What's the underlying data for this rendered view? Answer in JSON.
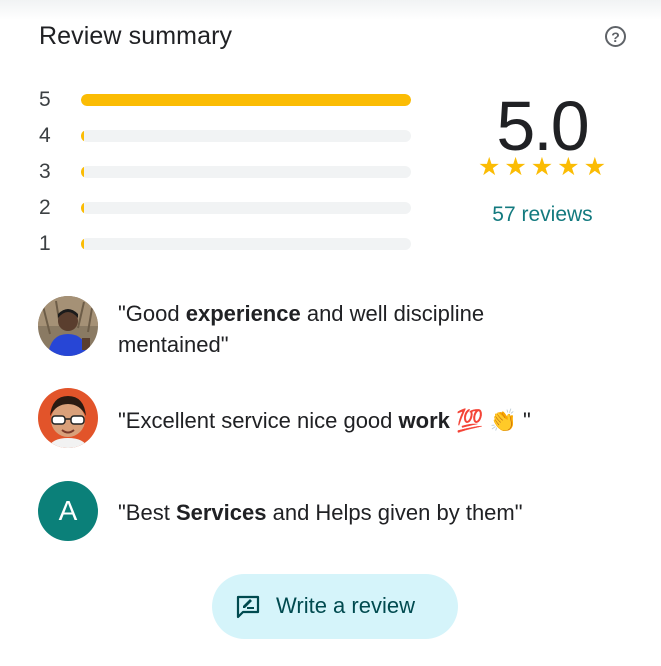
{
  "header": {
    "title": "Review summary",
    "help_glyph": "?"
  },
  "rating_bars": [
    {
      "star": "5",
      "fraction": 1.0
    },
    {
      "star": "4",
      "fraction": 0.0
    },
    {
      "star": "3",
      "fraction": 0.0
    },
    {
      "star": "2",
      "fraction": 0.0
    },
    {
      "star": "1",
      "fraction": 0.0
    }
  ],
  "summary": {
    "average": "5.0",
    "stars_filled": 5,
    "review_count_text": "57 reviews"
  },
  "snippets": [
    {
      "avatar_icon": "user-photo-icon",
      "parts": [
        "\"Good ",
        "experience",
        " and well discipline mentained\""
      ],
      "bold_index": 1
    },
    {
      "avatar_icon": "user-photo-icon",
      "parts": [
        "\"Excellent service nice good ",
        "work",
        " 💯 👏 \""
      ],
      "bold_index": 1
    },
    {
      "avatar_letter": "A",
      "avatar_color": "#0b8079",
      "parts": [
        "\"Best ",
        "Services",
        " and Helps given by them\""
      ],
      "bold_index": 1
    }
  ],
  "write_review": {
    "label": "Write a review",
    "icon": "rate-review-icon"
  },
  "colors": {
    "star": "#fbbc04",
    "link": "#137a7f",
    "button_bg": "#d5f4fa"
  }
}
